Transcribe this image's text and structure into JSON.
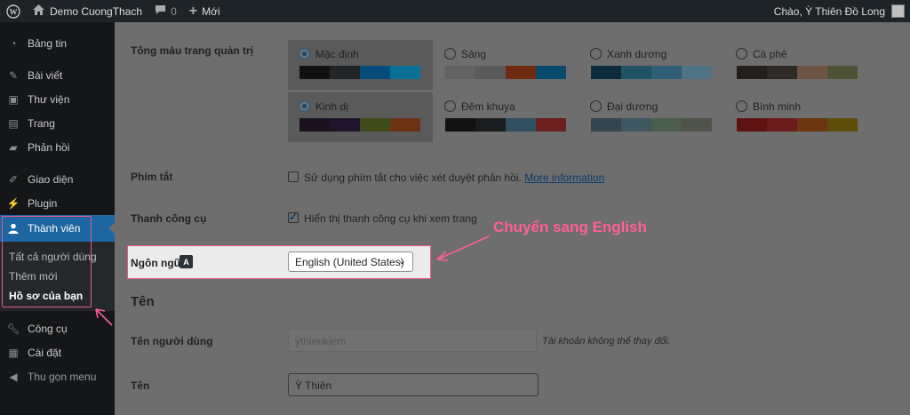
{
  "adminbar": {
    "site_name": "Demo CuongThach",
    "comments_count": "0",
    "new_label": "Mới",
    "greeting": "Chào, Ỳ Thiên Đồ Long"
  },
  "sidebar": {
    "items": [
      {
        "label": "Bảng tin",
        "icon": "dashboard-icon"
      },
      {
        "label": "Bài viết",
        "icon": "pin-icon"
      },
      {
        "label": "Thư viện",
        "icon": "media-icon"
      },
      {
        "label": "Trang",
        "icon": "page-icon"
      },
      {
        "label": "Phản hồi",
        "icon": "comment-icon"
      },
      {
        "label": "Giao diện",
        "icon": "brush-icon"
      },
      {
        "label": "Plugin",
        "icon": "plugin-icon"
      },
      {
        "label": "Thành viên",
        "icon": "user-icon"
      },
      {
        "label": "Công cụ",
        "icon": "wrench-icon"
      },
      {
        "label": "Cài đặt",
        "icon": "settings-icon"
      },
      {
        "label": "Thu gọn menu",
        "icon": "collapse-icon"
      }
    ],
    "submenu": [
      {
        "label": "Tất cả người dùng"
      },
      {
        "label": "Thêm mới"
      },
      {
        "label": "Hồ sơ của bạn"
      }
    ]
  },
  "form": {
    "color_scheme_label": "Tông màu trang quản trị",
    "schemes": [
      {
        "name": "Mặc định",
        "selected": true,
        "colors": [
          "#111111",
          "#222527",
          "#074b7a",
          "#0a6f97"
        ]
      },
      {
        "name": "Sáng",
        "selected": false,
        "colors": [
          "#626262",
          "#5a5a5a",
          "#6e2b10",
          "#074a6b"
        ]
      },
      {
        "name": "Xanh dương",
        "selected": false,
        "colors": [
          "#0c2c3c",
          "#205266",
          "#2d5d77",
          "#4e7385"
        ]
      },
      {
        "name": "Cà phê",
        "selected": false,
        "colors": [
          "#221f1c",
          "#2e2a26",
          "#6c5547",
          "#4f5336"
        ]
      },
      {
        "name": "Kinh dị",
        "selected": false,
        "colors": [
          "#1b1220",
          "#1f1429",
          "#3f4b1a",
          "#6b3313"
        ]
      },
      {
        "name": "Đêm khuya",
        "selected": false,
        "colors": [
          "#121212",
          "#1b1c1d",
          "#2f4f5e",
          "#6b1f1f"
        ]
      },
      {
        "name": "Đại dương",
        "selected": false,
        "colors": [
          "#33454d",
          "#3f5760",
          "#4c5e4b",
          "#4f5349"
        ]
      },
      {
        "name": "Bình minh",
        "selected": false,
        "colors": [
          "#5e1212",
          "#6c1d1b",
          "#6b3611",
          "#5c4d0c"
        ]
      }
    ],
    "shortcuts_label": "Phím tắt",
    "shortcuts_text": "Sử dụng phím tắt cho việc xét duyệt phản hồi.",
    "shortcuts_link": "More information",
    "toolbar_label": "Thanh công cụ",
    "toolbar_text": "Hiển thị thanh công cụ khi xem trang",
    "language_label": "Ngôn ngữ",
    "language_value": "English (United States)",
    "annotation": "Chuyển sang English",
    "name_section": "Tên",
    "username_label": "Tên người dùng",
    "username_value": "ythienkiem",
    "username_note": "Tài khoản không thể thay đổi.",
    "firstname_label": "Tên",
    "firstname_value": "Ỳ Thiên"
  },
  "colors": {
    "accent": "#1c66a1",
    "highlight": "#e25c8f",
    "annotation": "#ff5f98"
  }
}
